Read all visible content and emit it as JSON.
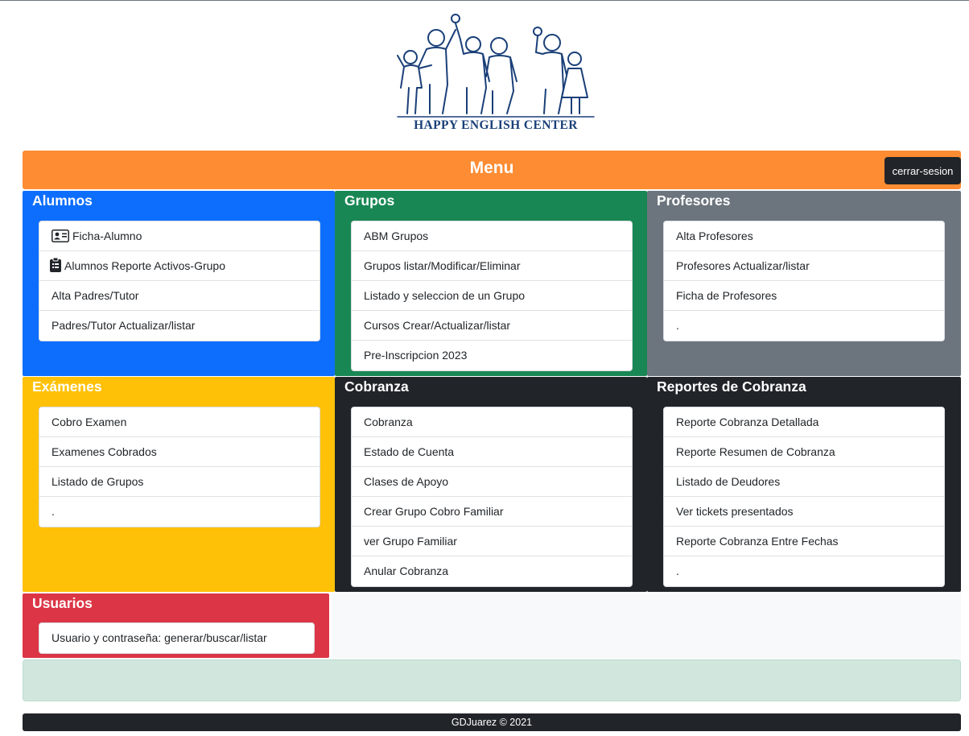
{
  "brand": {
    "name": "HAPPY ENGLISH CENTER"
  },
  "menu": {
    "title": "Menu",
    "logout_label": "cerrar-sesion"
  },
  "colors": {
    "menu_bar": "#fd8c33",
    "alumnos": "#0d6efd",
    "grupos": "#198754",
    "profesores": "#6c757d",
    "examenes": "#ffc107",
    "cobranza": "#212529",
    "reportes": "#212529",
    "usuarios": "#dc3545",
    "alert": "#d1e7dd",
    "footer": "#212529"
  },
  "panels": {
    "alumnos": {
      "title": "Alumnos",
      "items": [
        {
          "label": "Ficha-Alumno",
          "icon": "id-card-icon"
        },
        {
          "label": "Alumnos Reporte Activos-Grupo",
          "icon": "clipboard-list-icon"
        },
        {
          "label": "Alta Padres/Tutor"
        },
        {
          "label": "Padres/Tutor Actualizar/listar"
        }
      ]
    },
    "grupos": {
      "title": "Grupos",
      "items": [
        {
          "label": "ABM Grupos"
        },
        {
          "label": "Grupos listar/Modificar/Eliminar"
        },
        {
          "label": "Listado y seleccion de un Grupo"
        },
        {
          "label": "Cursos Crear/Actualizar/listar"
        },
        {
          "label": "Pre-Inscripcion 2023"
        }
      ]
    },
    "profesores": {
      "title": "Profesores",
      "items": [
        {
          "label": "Alta Profesores"
        },
        {
          "label": "Profesores Actualizar/listar"
        },
        {
          "label": "Ficha de Profesores"
        },
        {
          "label": "."
        }
      ]
    },
    "examenes": {
      "title": "Exámenes",
      "items": [
        {
          "label": "Cobro Examen"
        },
        {
          "label": "Examenes Cobrados"
        },
        {
          "label": "Listado de Grupos"
        },
        {
          "label": "."
        }
      ]
    },
    "cobranza": {
      "title": "Cobranza",
      "items": [
        {
          "label": "Cobranza"
        },
        {
          "label": "Estado de Cuenta"
        },
        {
          "label": "Clases de Apoyo"
        },
        {
          "label": "Crear Grupo Cobro Familiar"
        },
        {
          "label": "ver Grupo Familiar"
        },
        {
          "label": "Anular Cobranza"
        }
      ]
    },
    "reportes": {
      "title": "Reportes de Cobranza",
      "items": [
        {
          "label": "Reporte Cobranza Detallada"
        },
        {
          "label": "Reporte Resumen de Cobranza"
        },
        {
          "label": "Listado de Deudores"
        },
        {
          "label": "Ver tickets presentados"
        },
        {
          "label": "Reporte Cobranza Entre Fechas"
        },
        {
          "label": "."
        }
      ]
    },
    "usuarios": {
      "title": "Usuarios",
      "items": [
        {
          "label": "Usuario y contraseña: generar/buscar/listar"
        }
      ]
    }
  },
  "footer": {
    "text": "GDJuarez © 2021"
  }
}
